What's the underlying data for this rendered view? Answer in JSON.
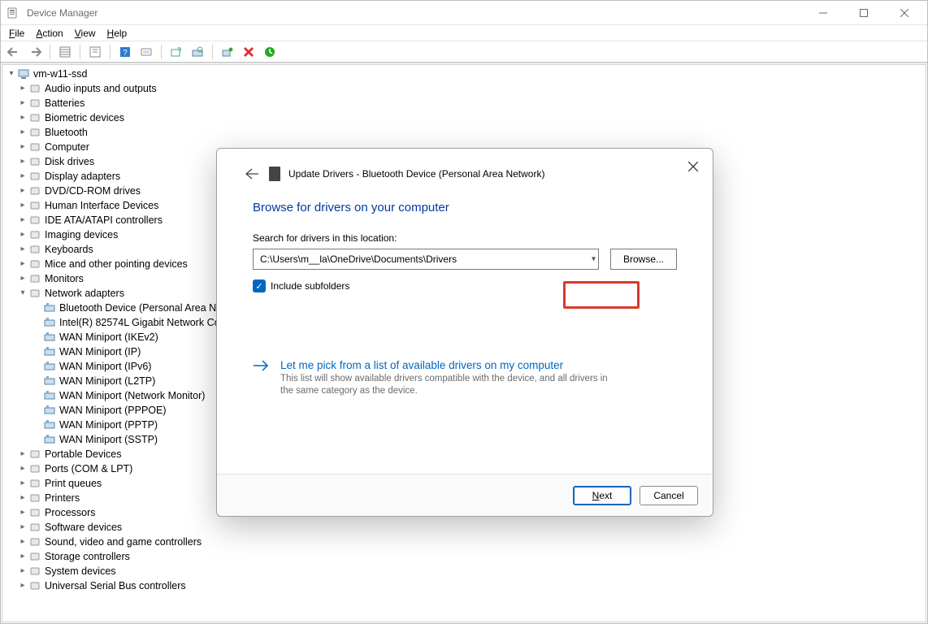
{
  "window": {
    "title": "Device Manager",
    "menus": [
      "File",
      "Action",
      "View",
      "Help"
    ]
  },
  "tree": {
    "root": "vm-w11-ssd",
    "categories": [
      {
        "label": "Audio inputs and outputs",
        "expanded": false
      },
      {
        "label": "Batteries",
        "expanded": false
      },
      {
        "label": "Biometric devices",
        "expanded": false
      },
      {
        "label": "Bluetooth",
        "expanded": false
      },
      {
        "label": "Computer",
        "expanded": false
      },
      {
        "label": "Disk drives",
        "expanded": false
      },
      {
        "label": "Display adapters",
        "expanded": false
      },
      {
        "label": "DVD/CD-ROM drives",
        "expanded": false
      },
      {
        "label": "Human Interface Devices",
        "expanded": false
      },
      {
        "label": "IDE ATA/ATAPI controllers",
        "expanded": false
      },
      {
        "label": "Imaging devices",
        "expanded": false
      },
      {
        "label": "Keyboards",
        "expanded": false
      },
      {
        "label": "Mice and other pointing devices",
        "expanded": false
      },
      {
        "label": "Monitors",
        "expanded": false
      },
      {
        "label": "Network adapters",
        "expanded": true,
        "children": [
          "Bluetooth Device (Personal Area N",
          "Intel(R) 82574L Gigabit Network Co",
          "WAN Miniport (IKEv2)",
          "WAN Miniport (IP)",
          "WAN Miniport (IPv6)",
          "WAN Miniport (L2TP)",
          "WAN Miniport (Network Monitor)",
          "WAN Miniport (PPPOE)",
          "WAN Miniport (PPTP)",
          "WAN Miniport (SSTP)"
        ]
      },
      {
        "label": "Portable Devices",
        "expanded": false
      },
      {
        "label": "Ports (COM & LPT)",
        "expanded": false
      },
      {
        "label": "Print queues",
        "expanded": false
      },
      {
        "label": "Printers",
        "expanded": false
      },
      {
        "label": "Processors",
        "expanded": false
      },
      {
        "label": "Software devices",
        "expanded": false
      },
      {
        "label": "Sound, video and game controllers",
        "expanded": false
      },
      {
        "label": "Storage controllers",
        "expanded": false
      },
      {
        "label": "System devices",
        "expanded": false
      },
      {
        "label": "Universal Serial Bus controllers",
        "expanded": false
      }
    ]
  },
  "dialog": {
    "title_prefix": "Update Drivers - ",
    "device": "Bluetooth Device (Personal Area Network)",
    "heading": "Browse for drivers on your computer",
    "search_label": "Search for drivers in this location:",
    "path": "C:\\Users\\m__la\\OneDrive\\Documents\\Drivers",
    "browse_label": "Browse...",
    "include_subfolders": "Include subfolders",
    "pick_heading": "Let me pick from a list of available drivers on my computer",
    "pick_sub": "This list will show available drivers compatible with the device, and all drivers in the same category as the device.",
    "next": "Next",
    "cancel": "Cancel"
  }
}
